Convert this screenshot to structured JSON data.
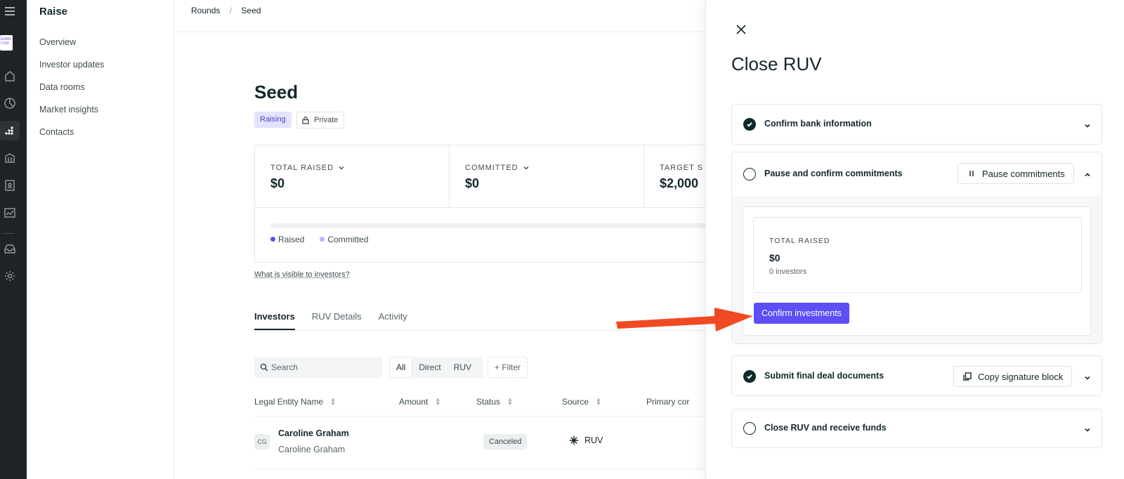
{
  "app": {
    "logo_text": "EXAM COM"
  },
  "sidebar": {
    "title": "Raise",
    "items": [
      {
        "label": "Overview"
      },
      {
        "label": "Investor updates"
      },
      {
        "label": "Data rooms"
      },
      {
        "label": "Market insights"
      },
      {
        "label": "Contacts"
      }
    ]
  },
  "breadcrumb": {
    "items": [
      "Rounds",
      "Seed"
    ],
    "separator": "/"
  },
  "round": {
    "title": "Seed",
    "status_badge": "Raising",
    "visibility_badge": "Private"
  },
  "stats": {
    "total_raised": {
      "label": "TOTAL RAISED",
      "value": "$0"
    },
    "committed": {
      "label": "COMMITTED",
      "value": "$0"
    },
    "target": {
      "label": "TARGET S",
      "value": "$2,000"
    },
    "legend": {
      "raised": "Raised",
      "committed": "Committed"
    },
    "colors": {
      "raised": "#5b4ff5",
      "committed": "#b9b4fb"
    }
  },
  "visibility_link": "What is visible to investors?",
  "tabs": [
    {
      "label": "Investors",
      "active": true
    },
    {
      "label": "RUV Details",
      "active": false
    },
    {
      "label": "Activity",
      "active": false
    }
  ],
  "filters": {
    "search_placeholder": "Search",
    "segments": [
      "All",
      "Direct",
      "RUV"
    ],
    "active_segment": "All",
    "filter_label": "+ Filter"
  },
  "table": {
    "columns": [
      "Legal Entity Name",
      "Amount",
      "Status",
      "Source",
      "Primary cor"
    ],
    "rows": [
      {
        "initials": "CG",
        "name": "Caroline Graham",
        "subname": "Caroline Graham",
        "amount": "",
        "status": "Canceled",
        "source": "RUV"
      }
    ]
  },
  "panel": {
    "title": "Close RUV",
    "steps": [
      {
        "label": "Confirm bank information",
        "done": true,
        "expanded": false
      },
      {
        "label": "Pause and confirm commitments",
        "done": false,
        "expanded": true,
        "action": "Pause commitments"
      },
      {
        "label": "Submit final deal documents",
        "done": true,
        "expanded": false,
        "action": "Copy signature block"
      },
      {
        "label": "Close RUV and receive funds",
        "done": false,
        "expanded": false
      }
    ],
    "expanded_card": {
      "label": "TOTAL RAISED",
      "value": "$0",
      "sub": "0 investors",
      "button": "Confirm investments"
    }
  },
  "accent_color": "#5b4ff5",
  "annotation_arrow_color": "#f04a23"
}
